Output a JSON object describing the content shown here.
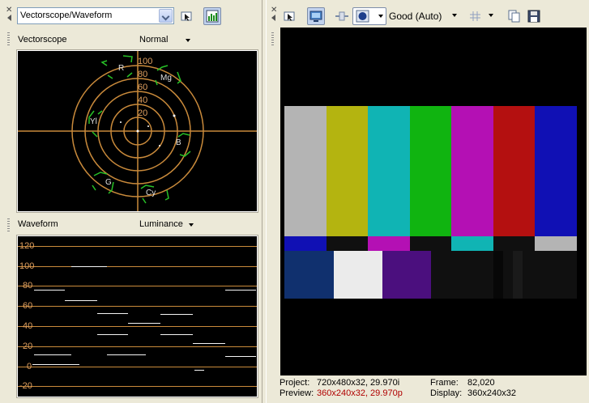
{
  "left": {
    "combo_value": "Vectorscope/Waveform",
    "vectorscope": {
      "title": "Vectorscope",
      "mode": "Normal",
      "ring_labels": [
        "100",
        "80",
        "60",
        "40",
        "20"
      ],
      "targets": [
        "R",
        "Mg",
        "Yl",
        "B",
        "G",
        "Cy"
      ]
    },
    "waveform": {
      "title": "Waveform",
      "mode": "Luminance",
      "y_labels": [
        "120",
        "100",
        "80",
        "60",
        "40",
        "20",
        "0",
        "-20"
      ]
    }
  },
  "right": {
    "quality_label": "Good (Auto)",
    "status": {
      "project_label": "Project:",
      "project_value": "720x480x32, 29.970i",
      "preview_label": "Preview:",
      "preview_value": "360x240x32, 29.970p",
      "frame_label": "Frame:",
      "frame_value": "82,020",
      "display_label": "Display:",
      "display_value": "360x240x32"
    }
  },
  "colors": {
    "graticule": "#c98a3b",
    "vector_target": "#27c127",
    "preview_red": "#b00000"
  }
}
